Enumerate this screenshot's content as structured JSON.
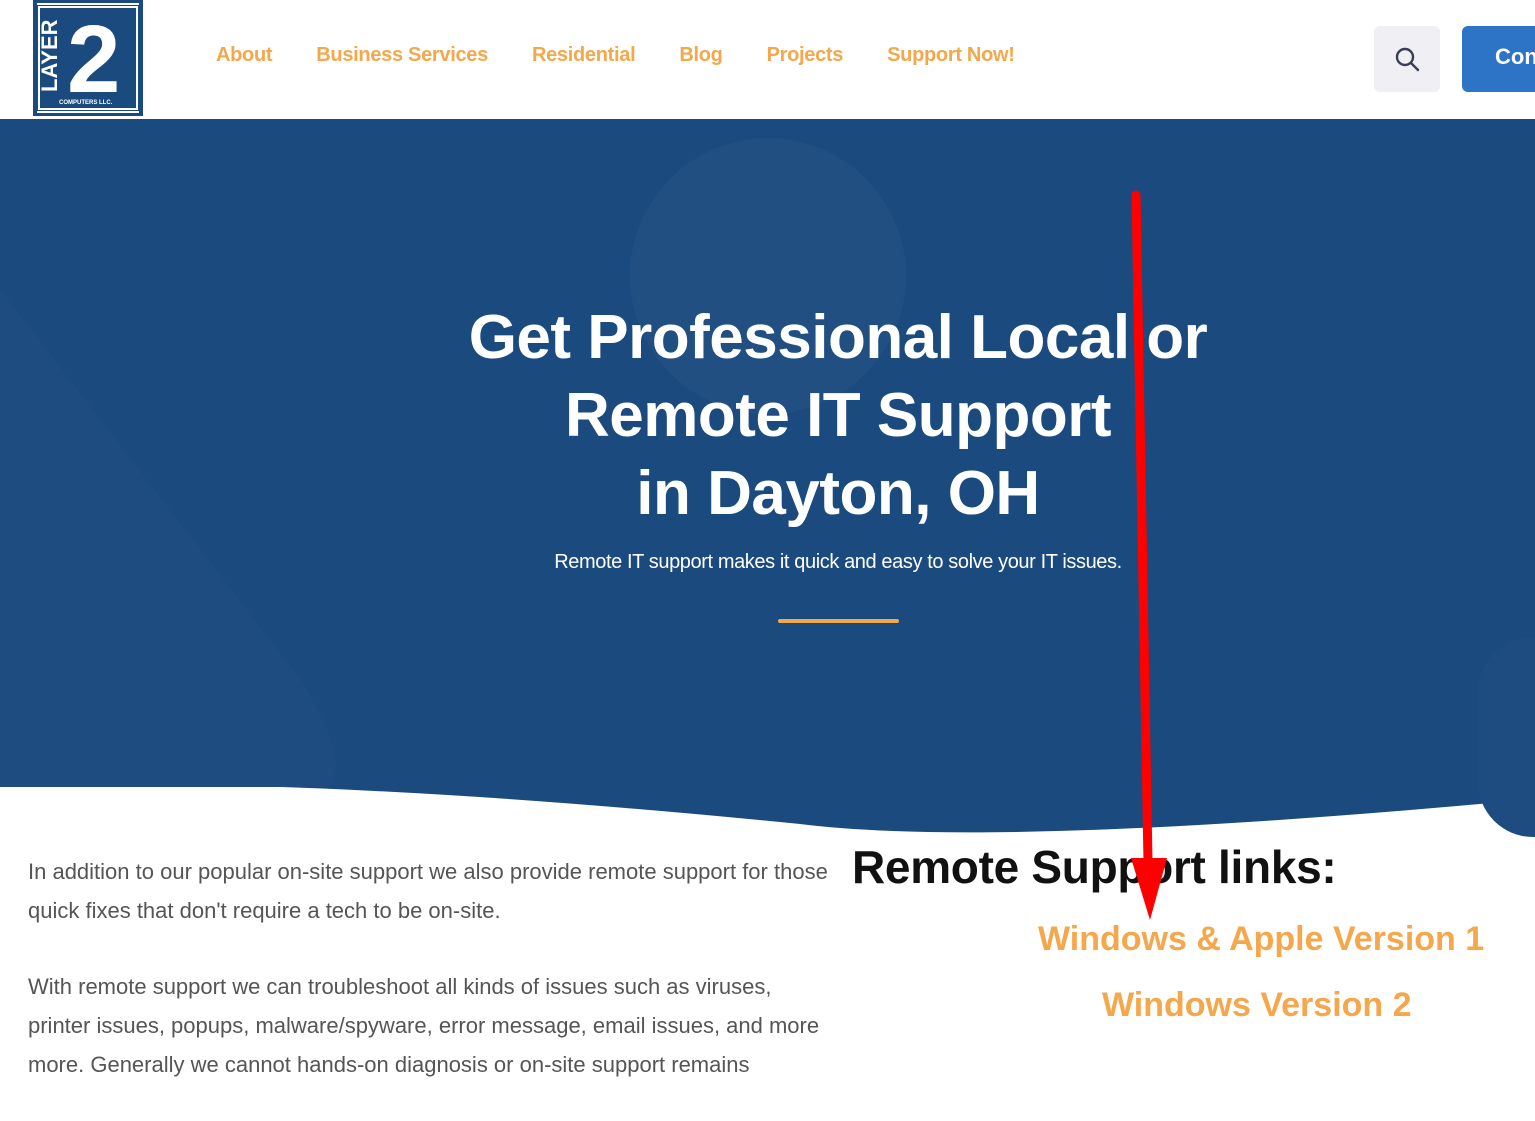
{
  "brand": {
    "logo_text": "LAYER 2",
    "logo_subtext": "COMPUTERS LLC"
  },
  "nav": {
    "items": [
      {
        "label": "About"
      },
      {
        "label": "Business Services"
      },
      {
        "label": "Residential"
      },
      {
        "label": "Blog"
      },
      {
        "label": "Projects"
      },
      {
        "label": "Support Now!"
      }
    ]
  },
  "header": {
    "contact_label": "Con"
  },
  "hero": {
    "title_lines": [
      "Get Professional Local or",
      "Remote IT Support",
      "in Dayton, OH"
    ],
    "subtitle": "Remote IT support makes it quick and easy to solve your IT issues."
  },
  "content": {
    "paragraph1": "In addition to our popular on-site support we also provide remote support for those quick fixes that don't require a tech to be on-site.",
    "paragraph2": "With remote support we can troubleshoot all kinds of issues such as viruses, printer issues, popups, malware/spyware, error message, email issues, and more more. Generally we cannot hands-on diagnosis or on-site support remains"
  },
  "remote_links": {
    "heading": "Remote Support links:",
    "links": [
      {
        "label": "Windows & Apple Version 1"
      },
      {
        "label": "Windows Version 2"
      }
    ]
  },
  "colors": {
    "accent_orange": "#f5a74b",
    "hero_blue": "#1b4a7e",
    "button_blue": "#2e74c6",
    "annotation_red": "#ff0000"
  },
  "icons": {
    "search": "search-icon",
    "annotation": "red-arrow-annotation"
  }
}
